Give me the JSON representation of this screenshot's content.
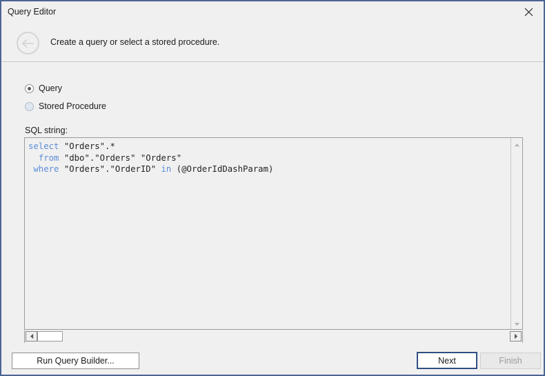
{
  "window": {
    "title": "Query Editor",
    "close_icon": "close-icon",
    "border_color": "#4a6493",
    "background": "#f0f0f0"
  },
  "header": {
    "back_icon": "arrow-left-icon",
    "caption": "Create a query or select a stored procedure."
  },
  "options": {
    "query": {
      "label": "Query",
      "selected": true
    },
    "stored_procedure": {
      "label": "Stored Procedure",
      "selected": false
    }
  },
  "sql": {
    "label": "SQL string:",
    "lines": [
      "select \"Orders\".*",
      "  from \"dbo\".\"Orders\" \"Orders\"",
      " where \"Orders\".\"OrderID\" in (@OrderIdDashParam)"
    ],
    "text": "select \"Orders\".*\n  from \"dbo\".\"Orders\" \"Orders\"\n where \"Orders\".\"OrderID\" in (@OrderIdDashParam)",
    "keywords": [
      "select",
      "from",
      "where",
      "in"
    ],
    "keyword_color": "#5b8dd9",
    "text_color": "#232323"
  },
  "scrollbars": {
    "vertical_up_icon": "triangle-up-icon",
    "vertical_down_icon": "triangle-down-icon",
    "horizontal_left_icon": "triangle-left-icon",
    "horizontal_right_icon": "triangle-right-icon"
  },
  "footer": {
    "run_query_builder_label": "Run Query Builder...",
    "next_label": "Next",
    "finish_label": "Finish",
    "next_focus_color": "#2f4f82",
    "finish_disabled": true
  }
}
